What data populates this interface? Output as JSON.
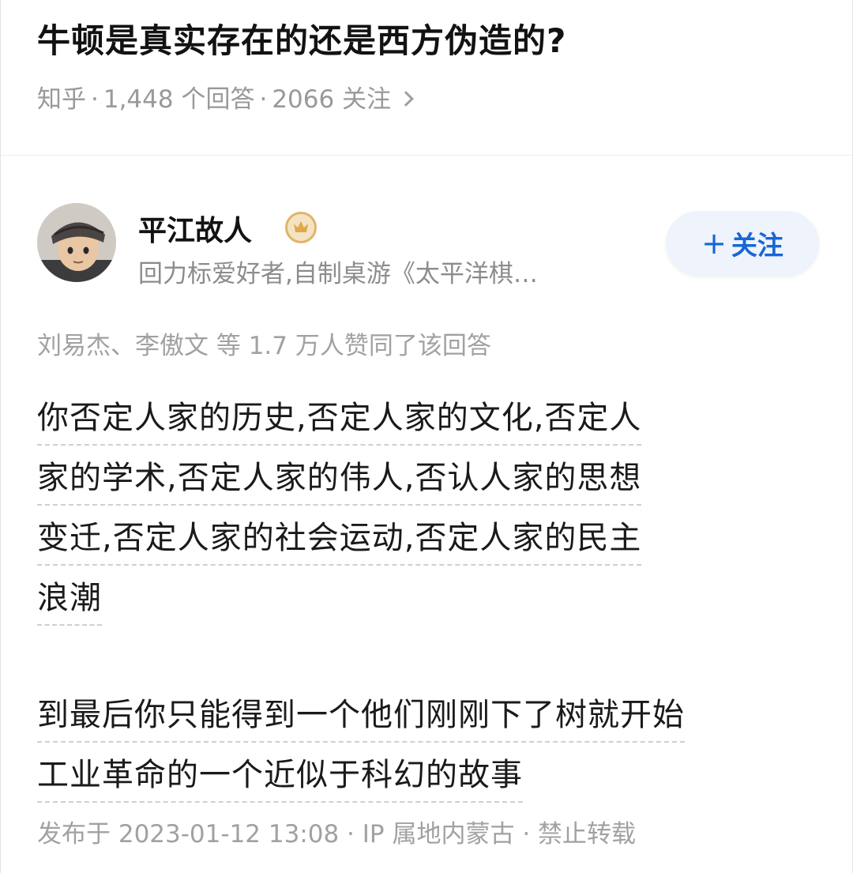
{
  "question": {
    "title": "牛顿是真实存在的还是西方伪造的?",
    "source": "知乎",
    "answers_count": "1,448 个回答",
    "followers_count": "2066 关注"
  },
  "author": {
    "name": "平江故人",
    "badge_icon": "crown-icon",
    "bio": "回力标爱好者,自制桌游《太平洋棋…",
    "follow_label": "关注"
  },
  "votes": {
    "text": "刘易杰、李傲文 等 1.7 万人赞同了该回答"
  },
  "answer": {
    "paragraphs": [
      {
        "lines": [
          "你否定人家的历史,否定人家的文化,否定人",
          "家的学术,否定人家的伟人,否认人家的思想",
          "变迁,否定人家的社会运动,否定人家的民主",
          "浪潮"
        ]
      },
      {
        "lines": [
          "到最后你只能得到一个他们刚刚下了树就开始",
          "工业革命的一个近似于科幻的故事"
        ]
      }
    ]
  },
  "footer": {
    "published": "发布于 2023-01-12 13:08",
    "ip": "IP 属地内蒙古",
    "copyright": "禁止转载"
  },
  "colors": {
    "accent": "#1766d6",
    "follow_bg": "#eef3fc",
    "muted_text": "#999999",
    "badge_gold": "#e0b46a"
  }
}
